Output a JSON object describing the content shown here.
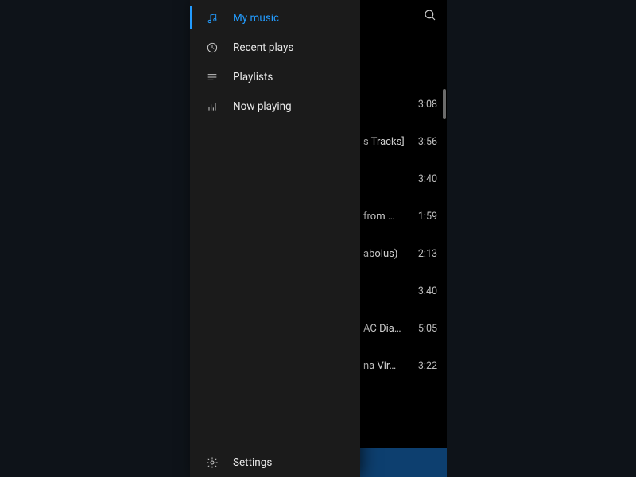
{
  "drawer": {
    "items": [
      {
        "label": "My music",
        "icon": "music-note-icon",
        "active": true
      },
      {
        "label": "Recent plays",
        "icon": "clock-icon",
        "active": false
      },
      {
        "label": "Playlists",
        "icon": "playlist-icon",
        "active": false
      },
      {
        "label": "Now playing",
        "icon": "equalizer-icon",
        "active": false
      }
    ],
    "footer": {
      "label": "Settings",
      "icon": "gear-icon"
    }
  },
  "tracklist": {
    "visible_tracks": [
      {
        "title_tail": "",
        "duration": "3:08"
      },
      {
        "title_tail": "s Tracks]",
        "duration": "3:56"
      },
      {
        "title_tail": "",
        "duration": "3:40"
      },
      {
        "title_tail": "from …",
        "duration": "1:59"
      },
      {
        "title_tail": "abolus)",
        "duration": "2:13"
      },
      {
        "title_tail": "",
        "duration": "3:40"
      },
      {
        "title_tail": "AC Dia…",
        "duration": "5:05"
      },
      {
        "title_tail": "na Vir…",
        "duration": "3:22"
      }
    ]
  },
  "colors": {
    "accent": "#239cff",
    "player_bg": "#0d3f6f"
  }
}
